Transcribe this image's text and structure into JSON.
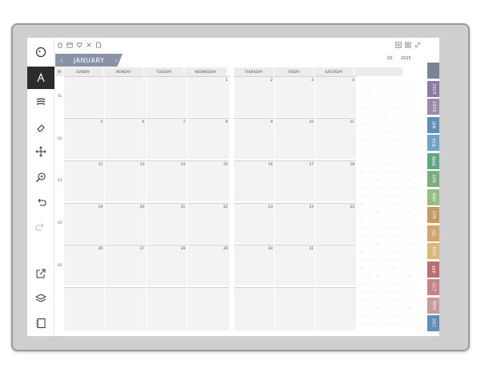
{
  "calendar": {
    "month": "JANUARY",
    "prev_icon": "chevron-left-icon",
    "next_icon": "chevron-right-icon",
    "quarter": "Q1",
    "year": "2025",
    "week_col_label": "W",
    "days_left": [
      "SUNDAY",
      "MONDAY",
      "TUESDAY",
      "WEDNESDAY"
    ],
    "days_right": [
      "THURSDAY",
      "FRIDAY",
      "SATURDAY"
    ],
    "weeks": [
      "01",
      "02",
      "03",
      "04",
      "05"
    ],
    "rows": [
      [
        "",
        "",
        "",
        "1",
        "2",
        "3",
        "4"
      ],
      [
        "5",
        "6",
        "7",
        "8",
        "9",
        "10",
        "11"
      ],
      [
        "12",
        "13",
        "14",
        "15",
        "16",
        "17",
        "18"
      ],
      [
        "19",
        "20",
        "21",
        "22",
        "23",
        "24",
        "25"
      ],
      [
        "26",
        "27",
        "28",
        "29",
        "30",
        "31",
        ""
      ],
      [
        "",
        "",
        "",
        "",
        "",
        "",
        ""
      ]
    ]
  },
  "month_tabs": [
    {
      "label": "",
      "color": "#7b8497"
    },
    {
      "label": "2025",
      "color": "#8a7aa8"
    },
    {
      "label": "2026",
      "color": "#9a8aae"
    },
    {
      "label": "JAN",
      "color": "#5f8fb8"
    },
    {
      "label": "FEB",
      "color": "#6ea3c8"
    },
    {
      "label": "MAR",
      "color": "#5fa884"
    },
    {
      "label": "APR",
      "color": "#77b07a"
    },
    {
      "label": "MAY",
      "color": "#94bf80"
    },
    {
      "label": "JUN",
      "color": "#c79a62"
    },
    {
      "label": "JUL",
      "color": "#d3a56c"
    },
    {
      "label": "AUG",
      "color": "#dbb676"
    },
    {
      "label": "SEP",
      "color": "#b96f6f"
    },
    {
      "label": "OCT",
      "color": "#c58383"
    },
    {
      "label": "NOV",
      "color": "#c99a9a"
    },
    {
      "label": "DEC",
      "color": "#5b8eb8"
    }
  ],
  "toolbar": {
    "icons": [
      "menu-circle-icon",
      "pen-icon",
      "stroke-width-icon",
      "eraser-icon",
      "move-icon",
      "zoom-icon",
      "undo-icon",
      "redo-icon",
      "share-icon",
      "layers-icon",
      "notebook-icon"
    ]
  },
  "header_icons_left": [
    "home-icon",
    "calendar-icon",
    "heart-icon",
    "tools-icon",
    "file-icon"
  ],
  "header_icons_right": [
    "settings-icon",
    "grid-icon",
    "link-icon"
  ]
}
